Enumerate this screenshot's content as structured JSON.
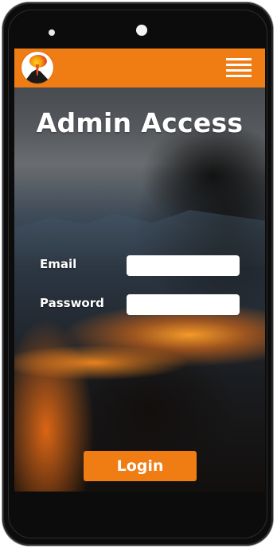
{
  "app": {
    "brand_color": "#f07c14",
    "logo_icon": "volcano-logo-icon",
    "menu_icon": "hamburger-menu-icon"
  },
  "page": {
    "title": "Admin Access"
  },
  "form": {
    "email_label": "Email",
    "email_value": "",
    "email_placeholder": "",
    "password_label": "Password",
    "password_value": "",
    "password_placeholder": "",
    "login_label": "Login"
  }
}
